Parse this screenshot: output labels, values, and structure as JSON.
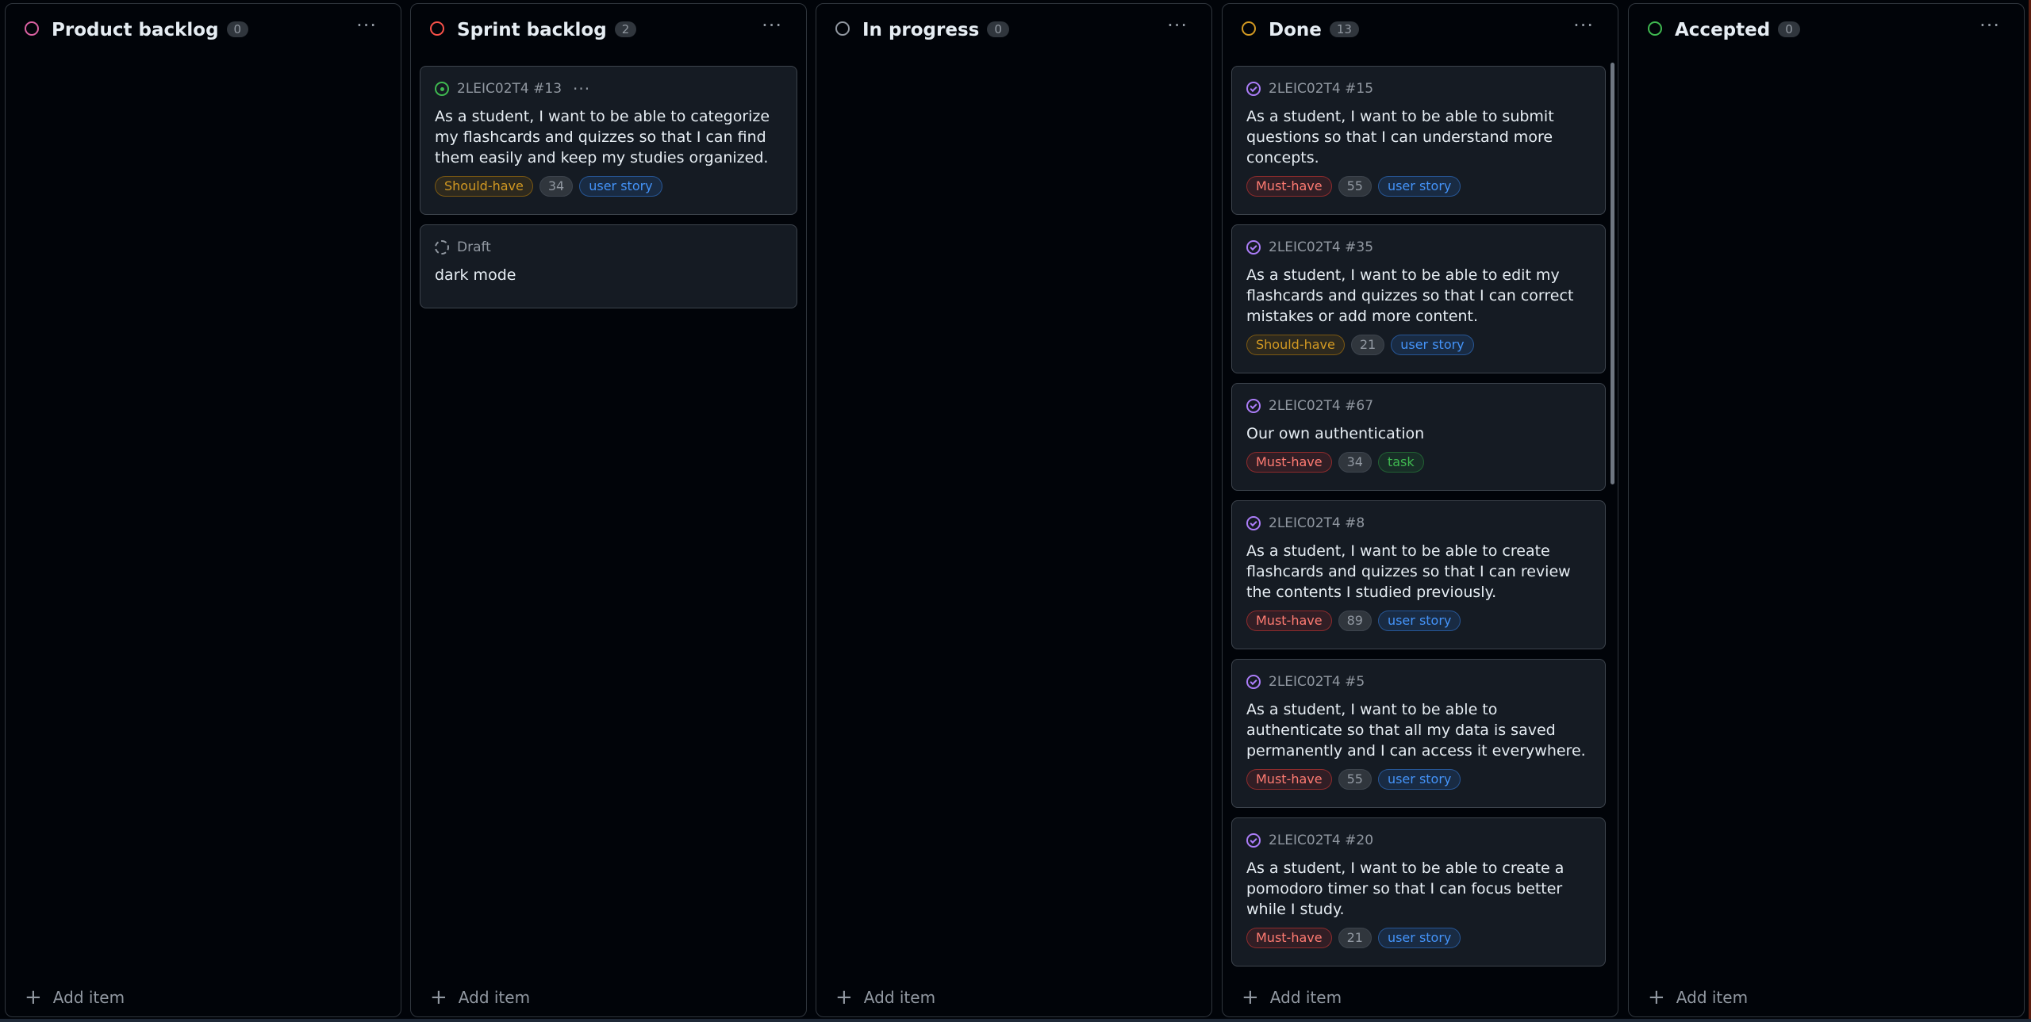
{
  "board": {
    "columns": [
      {
        "title": "Product backlog",
        "count": "0",
        "circle_color": "#db61a2",
        "add_label": "Add item",
        "menu": "···"
      },
      {
        "title": "Sprint backlog",
        "count": "2",
        "circle_color": "#f85149",
        "add_label": "Add item",
        "menu": "···"
      },
      {
        "title": "In progress",
        "count": "0",
        "circle_color": "#9198a1",
        "add_label": "Add item",
        "menu": "···"
      },
      {
        "title": "Done",
        "count": "13",
        "circle_color": "#d29922",
        "add_label": "Add item",
        "menu": "···"
      },
      {
        "title": "Accepted",
        "count": "0",
        "circle_color": "#3fb950",
        "add_label": "Add item",
        "menu": "···"
      }
    ]
  },
  "sprint_cards": [
    {
      "ref": "2LEIC02T4 #13",
      "menu": "···",
      "title": "As a student, I want to be able to categorize my flashcards and quizzes so that I can find them easily and keep my studies organized.",
      "priority": "Should-have",
      "points": "34",
      "type": "user story"
    },
    {
      "ref": "Draft",
      "title": "dark mode"
    }
  ],
  "done_cards": [
    {
      "ref": "2LEIC02T4 #15",
      "title": "As a student, I want to be able to submit questions so that I can understand more concepts.",
      "priority": "Must-have",
      "points": "55",
      "type": "user story"
    },
    {
      "ref": "2LEIC02T4 #35",
      "title": "As a student, I want to be able to edit my flashcards and quizzes so that I can correct mistakes or add more content.",
      "priority": "Should-have",
      "points": "21",
      "type": "user story"
    },
    {
      "ref": "2LEIC02T4 #67",
      "title": "Our own authentication",
      "priority": "Must-have",
      "points": "34",
      "type": "task"
    },
    {
      "ref": "2LEIC02T4 #8",
      "title": "As a student, I want to be able to create flashcards and quizzes so that I can review the contents I studied previously.",
      "priority": "Must-have",
      "points": "89",
      "type": "user story"
    },
    {
      "ref": "2LEIC02T4 #5",
      "title": "As a student, I want to be able to authenticate so that all my data is saved permanently and I can access it everywhere.",
      "priority": "Must-have",
      "points": "55",
      "type": "user story"
    },
    {
      "ref": "2LEIC02T4 #20",
      "title": "As a student, I want to be able to create a pomodoro timer so that I can focus better while I study.",
      "priority": "Must-have",
      "points": "21",
      "type": "user story"
    }
  ],
  "colors": {
    "background": "#010409",
    "card": "#151b23",
    "border": "#30363d",
    "must_have": "#ff7b72",
    "should_have": "#d29922",
    "user_story": "#4493f8",
    "task": "#3fb950",
    "closed_issue": "#ab7df8",
    "open_issue": "#3fb950"
  }
}
